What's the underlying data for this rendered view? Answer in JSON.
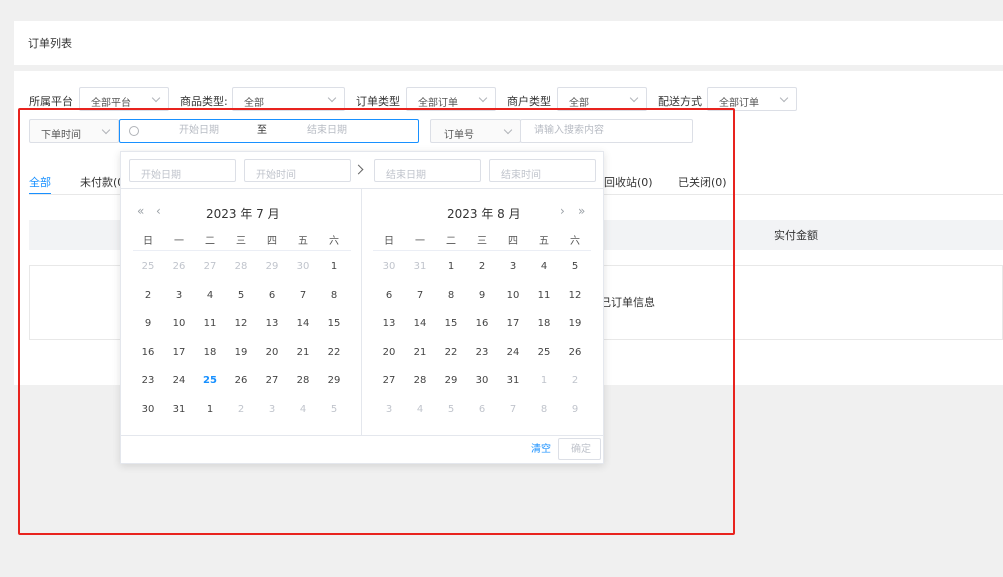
{
  "page": {
    "title": "订单列表"
  },
  "filters": {
    "platform": {
      "label": "所属平台",
      "value": "全部平台"
    },
    "goods_type": {
      "label": "商品类型:",
      "value": "全部"
    },
    "order_type": {
      "label": "订单类型",
      "value": "全部订单"
    },
    "merchant_type": {
      "label": "商户类型",
      "value": "全部"
    },
    "delivery": {
      "label": "配送方式",
      "value": "全部订单"
    },
    "time_field": {
      "value": "下单时间"
    },
    "date_range": {
      "start_placeholder": "开始日期",
      "separator": "至",
      "end_placeholder": "结束日期"
    },
    "search_field": {
      "value": "订单号"
    },
    "search": {
      "placeholder": "请输入搜索内容"
    }
  },
  "tabs": [
    {
      "label": "全部",
      "active": true
    },
    {
      "label": "未付款(0"
    },
    {
      "label": "回收站(0)"
    },
    {
      "label": "已关闭(0)"
    }
  ],
  "table": {
    "header_paid": "实付金额",
    "empty_text_fragment": "订单信息"
  },
  "picker": {
    "inputs": {
      "start_date": "开始日期",
      "start_time": "开始时间",
      "end_date": "结束日期",
      "end_time": "结束时间"
    },
    "weekdays": [
      "日",
      "一",
      "二",
      "三",
      "四",
      "五",
      "六"
    ],
    "left": {
      "title": "2023 年 7 月",
      "days": [
        [
          "25",
          "26",
          "27",
          "28",
          "29",
          "30",
          "1"
        ],
        [
          "2",
          "3",
          "4",
          "5",
          "6",
          "7",
          "8"
        ],
        [
          "9",
          "10",
          "11",
          "12",
          "13",
          "14",
          "15"
        ],
        [
          "16",
          "17",
          "18",
          "19",
          "20",
          "21",
          "22"
        ],
        [
          "23",
          "24",
          "25",
          "26",
          "27",
          "28",
          "29"
        ],
        [
          "30",
          "31",
          "1",
          "2",
          "3",
          "4",
          "5"
        ]
      ],
      "first_current_index": 6,
      "last_current_index": 37,
      "today_index": 30
    },
    "right": {
      "title": "2023 年 8 月",
      "days": [
        [
          "30",
          "31",
          "1",
          "2",
          "3",
          "4",
          "5"
        ],
        [
          "6",
          "7",
          "8",
          "9",
          "10",
          "11",
          "12"
        ],
        [
          "13",
          "14",
          "15",
          "16",
          "17",
          "18",
          "19"
        ],
        [
          "20",
          "21",
          "22",
          "23",
          "24",
          "25",
          "26"
        ],
        [
          "27",
          "28",
          "29",
          "30",
          "31",
          "1",
          "2"
        ],
        [
          "3",
          "4",
          "5",
          "6",
          "7",
          "8",
          "9"
        ]
      ],
      "first_current_index": 2,
      "last_current_index": 32
    },
    "footer": {
      "clear": "清空",
      "confirm": "确定"
    }
  },
  "colors": {
    "accent": "#1890ff",
    "highlight_border": "#e8231e"
  }
}
